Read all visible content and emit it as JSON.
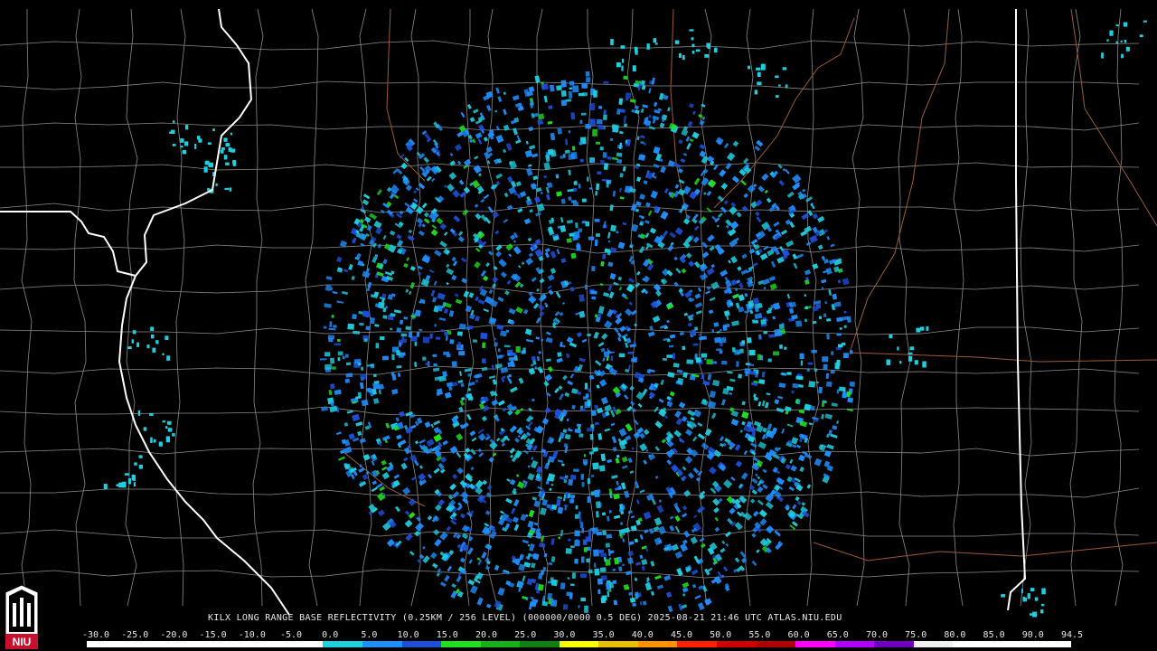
{
  "caption": "KILX LONG RANGE BASE REFLECTIVITY (0.25KM / 256 LEVEL) (000000/0000 0.5 DEG) 2025-08-21 21:46 UTC  ATLAS.NIU.EDU",
  "logo": {
    "text": "NIU",
    "color": "#c8102e"
  },
  "scale_labels": [
    "-30.0",
    "-25.0",
    "-20.0",
    "-15.0",
    "-10.0",
    "-5.0",
    "0.0",
    "5.0",
    "10.0",
    "15.0",
    "20.0",
    "25.0",
    "30.0",
    "35.0",
    "40.0",
    "45.0",
    "50.0",
    "55.0",
    "60.0",
    "65.0",
    "70.0",
    "75.0",
    "80.0",
    "85.0",
    "90.0",
    "94.5"
  ],
  "colorbar_colors": [
    "#ffffff",
    "#ffffff",
    "#ffffff",
    "#ffffff",
    "#ffffff",
    "#ffffff",
    "#1ecfe0",
    "#1f8fff",
    "#1f4fd8",
    "#20e020",
    "#18b018",
    "#108010",
    "#ffff00",
    "#e8c000",
    "#ff9000",
    "#ff2000",
    "#d00000",
    "#b00000",
    "#ff00ff",
    "#b000ff",
    "#7000c0",
    "#f0f0f0",
    "#ffffff",
    "#ffffff",
    "#ffffff"
  ],
  "colors": {
    "state_border": "#ffffff",
    "county_line": "#8a8a8a",
    "highway": "#9a5a38",
    "echo_cyan": "#1ecfe0",
    "echo_blue": "#1f8fff",
    "echo_dark_blue": "#1f4fd8",
    "echo_green": "#20e020"
  }
}
